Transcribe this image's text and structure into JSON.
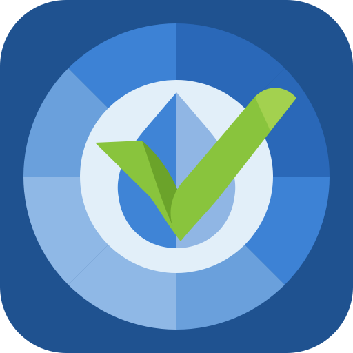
{
  "icon": {
    "glyph": "water-drop-checkmark-icon",
    "colors": {
      "tile": "#1f5290",
      "ring_light": "#8fb8e6",
      "ring_mid": "#6aa0dc",
      "ring_bright": "#3d82d5",
      "ring_dark": "#2a68b8",
      "inner_disc": "#e2eff9",
      "drop_left": "#3f84d6",
      "drop_right": "#90b6e4",
      "check_main": "#89c43d",
      "check_light": "#a3d14f",
      "check_shade": "#6ba32a"
    },
    "segments": [
      {
        "name": "top-left",
        "shade": "ring_bright"
      },
      {
        "name": "top-right",
        "shade": "ring_dark"
      },
      {
        "name": "right-upper",
        "shade": "ring_dark"
      },
      {
        "name": "right-lower",
        "shade": "ring_bright"
      },
      {
        "name": "bottom-right",
        "shade": "ring_mid"
      },
      {
        "name": "bottom-left",
        "shade": "ring_light"
      },
      {
        "name": "left-lower",
        "shade": "ring_light"
      },
      {
        "name": "left-upper",
        "shade": "ring_mid"
      }
    ]
  }
}
